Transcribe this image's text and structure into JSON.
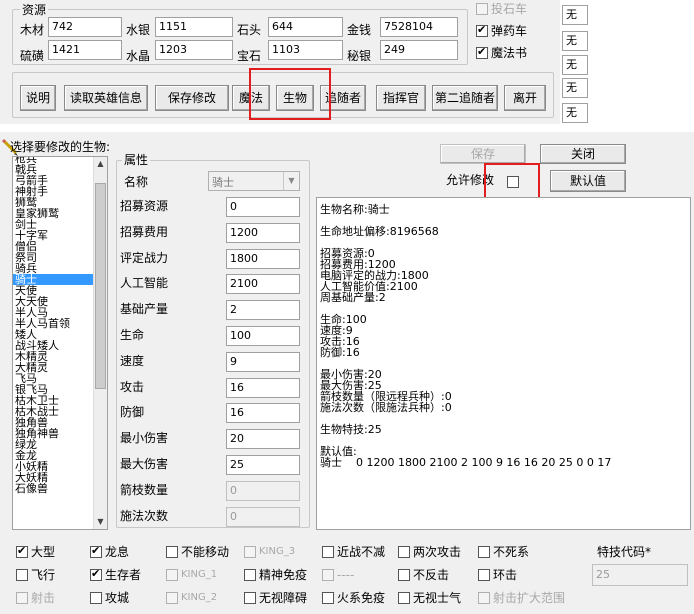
{
  "resources": {
    "title": "资源",
    "fields": [
      {
        "label": "木材",
        "value": "742"
      },
      {
        "label": "水银",
        "value": "1151"
      },
      {
        "label": "石头",
        "value": "644"
      },
      {
        "label": "金钱",
        "value": "7528104"
      },
      {
        "label": "硫磺",
        "value": "1421"
      },
      {
        "label": "水晶",
        "value": "1203"
      },
      {
        "label": "宝石",
        "value": "1103"
      },
      {
        "label": "秘银",
        "value": "249"
      }
    ]
  },
  "top_checks": [
    {
      "label": "投石车",
      "checked": false,
      "disabled": true
    },
    {
      "label": "弹药车",
      "checked": true,
      "disabled": false
    },
    {
      "label": "魔法书",
      "checked": true,
      "disabled": false
    }
  ],
  "right_values": [
    "无",
    "无",
    "无",
    "无",
    "无"
  ],
  "toolbar": [
    "说明",
    "读取英雄信息",
    "保存修改",
    "魔法",
    "生物",
    "追随者",
    "指挥官",
    "第二追随者",
    "离开"
  ],
  "creature_list": {
    "label": "选择要修改的生物:",
    "items": [
      "枪兵",
      "戟兵",
      "弓箭手",
      "神射手",
      "狮鹫",
      "皇家狮鹫",
      "剑士",
      "十字军",
      "僧侣",
      "祭司",
      "骑兵",
      "骑士",
      "天使",
      "大天使",
      "半人马",
      "半人马首领",
      "矮人",
      "战斗矮人",
      "木精灵",
      "大精灵",
      "飞马",
      "银飞马",
      "枯木卫士",
      "枯木战士",
      "独角兽",
      "独角神兽",
      "绿龙",
      "金龙",
      "小妖精",
      "大妖精",
      "石像兽"
    ],
    "selected": "骑士"
  },
  "attributes": {
    "title": "属性",
    "name_label": "名称",
    "name_value": "骑士",
    "rows": [
      {
        "label": "招募资源",
        "value": "0",
        "disabled": false
      },
      {
        "label": "招募费用",
        "value": "1200",
        "disabled": false
      },
      {
        "label": "评定战力",
        "value": "1800",
        "disabled": false
      },
      {
        "label": "人工智能",
        "value": "2100",
        "disabled": false
      },
      {
        "label": "基础产量",
        "value": "2",
        "disabled": false
      },
      {
        "label": "生命",
        "value": "100",
        "disabled": false
      },
      {
        "label": "速度",
        "value": "9",
        "disabled": false
      },
      {
        "label": "攻击",
        "value": "16",
        "disabled": false
      },
      {
        "label": "防御",
        "value": "16",
        "disabled": false
      },
      {
        "label": "最小伤害",
        "value": "20",
        "disabled": false
      },
      {
        "label": "最大伤害",
        "value": "25",
        "disabled": false
      },
      {
        "label": "箭枝数量",
        "value": "0",
        "disabled": true
      },
      {
        "label": "施法次数",
        "value": "0",
        "disabled": true
      }
    ]
  },
  "actions": {
    "save": "保存",
    "close": "关闭",
    "allow_edit": "允许修改",
    "allow_edit_checked": false,
    "default": "默认值"
  },
  "info_lines": [
    "生物名称:骑士",
    "",
    "生命地址偏移:8196568",
    "",
    "招募资源:0",
    "招募费用:1200",
    "电脑评定的战力:1800",
    "人工智能价值:2100",
    "周基础产量:2",
    "",
    "生命:100",
    "速度:9",
    "攻击:16",
    "防御:16",
    "",
    "最小伤害:20",
    "最大伤害:25",
    "箭枝数量（限远程兵种）:0",
    "施法次数（限施法兵种）:0",
    "",
    "生物特技:25",
    "",
    "默认值:",
    "骑士    0 1200 1800 2100 2 100 9 16 16 20 25 0 0 17"
  ],
  "flags": [
    {
      "label": "大型",
      "checked": true,
      "disabled": false
    },
    {
      "label": "龙息",
      "checked": true,
      "disabled": false
    },
    {
      "label": "不能移动",
      "checked": false,
      "disabled": false
    },
    {
      "label": "KING_3",
      "checked": false,
      "disabled": true
    },
    {
      "label": "近战不减",
      "checked": false,
      "disabled": false
    },
    {
      "label": "两次攻击",
      "checked": false,
      "disabled": false
    },
    {
      "label": "不死系",
      "checked": false,
      "disabled": false
    },
    {
      "label": "飞行",
      "checked": false,
      "disabled": false
    },
    {
      "label": "生存者",
      "checked": true,
      "disabled": false
    },
    {
      "label": "KING_1",
      "checked": false,
      "disabled": true
    },
    {
      "label": "精神免疫",
      "checked": false,
      "disabled": false
    },
    {
      "label": "----",
      "checked": false,
      "disabled": true
    },
    {
      "label": "不反击",
      "checked": false,
      "disabled": false
    },
    {
      "label": "环击",
      "checked": false,
      "disabled": false
    },
    {
      "label": "射击",
      "checked": false,
      "disabled": true
    },
    {
      "label": "攻城",
      "checked": false,
      "disabled": false
    },
    {
      "label": "KING_2",
      "checked": false,
      "disabled": true
    },
    {
      "label": "无视障碍",
      "checked": false,
      "disabled": false
    },
    {
      "label": "火系免疫",
      "checked": false,
      "disabled": false
    },
    {
      "label": "无视士气",
      "checked": false,
      "disabled": false
    },
    {
      "label": "射击扩大范围",
      "checked": false,
      "disabled": true
    }
  ],
  "special": {
    "label": "特技代码*",
    "value": "25"
  }
}
